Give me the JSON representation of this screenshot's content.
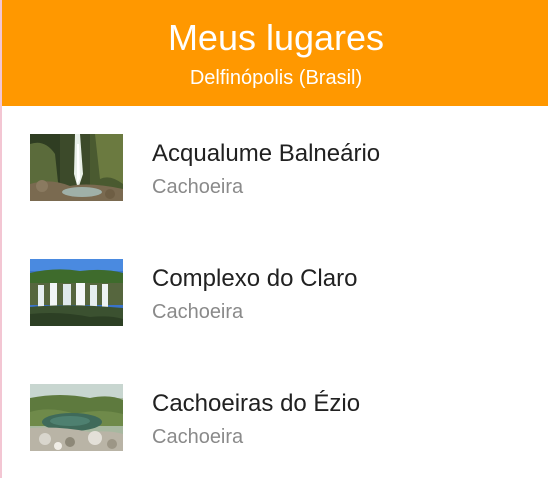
{
  "header": {
    "title": "Meus lugares",
    "subtitle": "Delfinópolis (Brasil)",
    "background_color": "#ff9800"
  },
  "places": [
    {
      "name": "Acqualume Balneário",
      "category": "Cachoeira",
      "thumbnail": "waterfall-forest-photo"
    },
    {
      "name": "Complexo do Claro",
      "category": "Cachoeira",
      "thumbnail": "waterfall-wide-photo"
    },
    {
      "name": "Cachoeiras do Ézio",
      "category": "Cachoeira",
      "thumbnail": "river-rocks-photo"
    }
  ]
}
